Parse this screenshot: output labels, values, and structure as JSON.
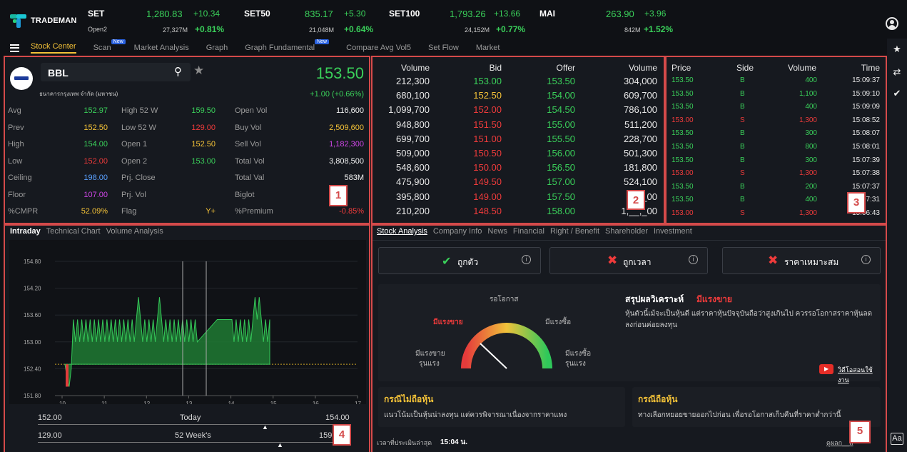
{
  "brand": "TRADEMAN",
  "indices": [
    {
      "name": "SET",
      "sub": "Open2",
      "value": "1,280.83",
      "change": "+10.34",
      "volume": "27,327M",
      "pct": "+0.81%"
    },
    {
      "name": "SET50",
      "sub": "",
      "value": "835.17",
      "change": "+5.30",
      "volume": "21,048M",
      "pct": "+0.64%"
    },
    {
      "name": "SET100",
      "sub": "",
      "value": "1,793.26",
      "change": "+13.66",
      "volume": "24,152M",
      "pct": "+0.77%"
    },
    {
      "name": "MAI",
      "sub": "",
      "value": "263.90",
      "change": "+3.96",
      "volume": "842M",
      "pct": "+1.52%"
    }
  ],
  "nav": {
    "items": [
      "Stock Center",
      "Scan",
      "Market Analysis",
      "Graph",
      "Graph Fundamental",
      "Compare Avg Vol5",
      "Set Flow",
      "Market"
    ],
    "new_badge": "New"
  },
  "quote": {
    "symbol": "BBL",
    "company": "ธนาคารกรุงเทพ จำกัด (มหาชน)",
    "price": "153.50",
    "change": "+1.00 (+0.66%)",
    "rows": [
      {
        "l1": "Avg",
        "v1": "152.97",
        "l2": "High 52 W",
        "v2": "159.50",
        "l3": "Open Vol",
        "v3": "116,600"
      },
      {
        "l1": "Prev",
        "v1": "152.50",
        "l2": "Low 52 W",
        "v2": "129.00",
        "l3": "Buy Vol",
        "v3": "2,509,600"
      },
      {
        "l1": "High",
        "v1": "154.00",
        "l2": "Open 1",
        "v2": "152.50",
        "l3": "Sell Vol",
        "v3": "1,182,300"
      },
      {
        "l1": "Low",
        "v1": "152.00",
        "l2": "Open 2",
        "v2": "153.00",
        "l3": "Total Vol",
        "v3": "3,808,500"
      },
      {
        "l1": "Ceiling",
        "v1": "198.00",
        "l2": "Prj. Close",
        "v2": "",
        "l3": "Total Val",
        "v3": "583M"
      },
      {
        "l1": "Floor",
        "v1": "107.00",
        "l2": "Prj. Vol",
        "v2": "",
        "l3": "Biglot",
        "v3": ""
      },
      {
        "l1": "%CMPR",
        "v1": "52.09%",
        "l2": "Flag",
        "v2": "Y+",
        "l3": "%Premium",
        "v3": "-0.85%"
      }
    ]
  },
  "bidoffer": {
    "headers": [
      "Volume",
      "Bid",
      "Offer",
      "Volume"
    ],
    "rows": [
      [
        "212,300",
        "153.00",
        "153.50",
        "304,000"
      ],
      [
        "680,100",
        "152.50",
        "154.00",
        "609,700"
      ],
      [
        "1,099,700",
        "152.00",
        "154.50",
        "786,100"
      ],
      [
        "948,800",
        "151.50",
        "155.00",
        "511,200"
      ],
      [
        "699,700",
        "151.00",
        "155.50",
        "228,700"
      ],
      [
        "509,000",
        "150.50",
        "156.00",
        "501,300"
      ],
      [
        "548,600",
        "150.00",
        "156.50",
        "181,800"
      ],
      [
        "475,900",
        "149.50",
        "157.00",
        "524,100"
      ],
      [
        "395,800",
        "149.00",
        "157.50",
        "5_,_00"
      ],
      [
        "210,200",
        "148.50",
        "158.00",
        "1,__,_00"
      ]
    ]
  },
  "ticks": {
    "headers": [
      "Price",
      "Side",
      "Volume",
      "Time"
    ],
    "rows": [
      [
        "153.50",
        "B",
        "400",
        "15:09:37"
      ],
      [
        "153.50",
        "B",
        "1,100",
        "15:09:10"
      ],
      [
        "153.50",
        "B",
        "400",
        "15:09:09"
      ],
      [
        "153.00",
        "S",
        "1,300",
        "15:08:52"
      ],
      [
        "153.50",
        "B",
        "300",
        "15:08:07"
      ],
      [
        "153.50",
        "B",
        "800",
        "15:08:01"
      ],
      [
        "153.50",
        "B",
        "300",
        "15:07:39"
      ],
      [
        "153.00",
        "S",
        "1,300",
        "15:07:38"
      ],
      [
        "153.50",
        "B",
        "200",
        "15:07:37"
      ],
      [
        "153.50",
        "B",
        "400",
        "15:07:31"
      ],
      [
        "153.00",
        "S",
        "1,300",
        "15:06:43"
      ]
    ]
  },
  "chart_tabs": [
    "Intraday",
    "Technical Chart",
    "Volume Analysis"
  ],
  "chart_data": {
    "type": "area",
    "title": "",
    "xlabel": "",
    "ylabel": "",
    "x_ticks": [
      "10",
      "11",
      "12",
      "13",
      "14",
      "15",
      "16",
      "17"
    ],
    "y_ticks": [
      "154.80",
      "154.20",
      "153.60",
      "153.00",
      "152.40",
      "151.80"
    ],
    "ylim": [
      151.8,
      154.8
    ],
    "prev_close": 152.5,
    "series": [
      {
        "values": [
          152.5,
          152.2,
          152.0,
          152.4,
          153.5,
          153.0,
          153.5,
          153.0,
          153.5,
          153.0,
          153.5,
          153.0,
          153.5,
          153.0,
          153.5,
          153.0,
          153.5,
          153.0,
          153.5,
          153.0,
          153.5,
          153.0,
          153.5,
          153.0,
          153.5,
          153.0,
          153.5,
          153.0,
          153.5,
          153.0,
          153.5,
          153.0,
          153.5,
          153.0,
          153.5,
          154.0,
          153.5,
          153.0,
          153.5,
          153.0,
          153.5,
          153.0,
          153.5,
          153.0,
          153.5,
          154.0,
          153.5,
          153.0,
          153.5,
          153.0,
          153.5,
          153.0,
          153.5,
          153.0,
          153.5,
          153.0,
          153.5,
          153.0,
          153.5,
          153.0,
          153.5,
          153.0,
          153.5,
          153.0,
          153.5,
          153.5,
          153.5,
          153.5,
          153.5,
          153.5,
          153.5,
          153.5,
          153.0,
          153.5,
          153.0,
          153.5,
          153.0,
          153.5,
          153.0,
          153.5,
          153.0,
          153.5,
          154.0,
          153.5,
          154.0,
          153.5,
          153.0,
          153.5,
          153.0,
          153.5
        ]
      }
    ]
  },
  "range": {
    "today_low": "152.00",
    "today_label": "Today",
    "today_high": "154.00",
    "w52_low": "129.00",
    "w52_label": "52 Week's",
    "w52_high": "159.50"
  },
  "analysis": {
    "tabs": [
      "Stock Analysis",
      "Company Info",
      "News",
      "Financial",
      "Right / Benefit",
      "Shareholder",
      "Investment"
    ],
    "buttons": [
      "ถูกตัว",
      "ถูกเวลา",
      "ราคาเหมาะสม"
    ],
    "gauge": {
      "top": "รอโอกาส",
      "left": "มีแรงขาย",
      "right": "มีแรงซื้อ",
      "bl1": "มีแรงขาย",
      "bl2": "รุนแรง",
      "br1": "มีแรงซื้อ",
      "br2": "รุนแรง"
    },
    "summary_title": "สรุปผลวิเคราะห์",
    "summary_status": "มีแรงขาย",
    "summary_text": "หุ้นตัวนี้เม้จะเป็นหุ้นดี แต่ราคาหุ้นปัจจุบันถือว่าสูงเกินไป ควรรอโอกาสราคาหุ้นลดลงก่อนค่อยลงทุน",
    "video_label": "วิดีโอสอนใช้งาน",
    "card1_title": "กรณีไม่ถือหุ้น",
    "card1_text": "แนวโน้มเป็นหุ้นน่าลงทุน แต่ควรพิจารณาเนื่องจากราคาแพง",
    "card2_title": "กรณีถือหุ้น",
    "card2_text": "ทางเลือกทยอยขายออกไปก่อน เพื่อรอโอกาสเก็บคืนที่ราคาต่ำกว่านี้",
    "footer_label": "เวลาที่ประเมินล่าสุด",
    "footer_time": "15:04 น.",
    "footer_right": "ดูผลก__ล"
  },
  "markers": [
    "1",
    "2",
    "3",
    "4",
    "5"
  ]
}
